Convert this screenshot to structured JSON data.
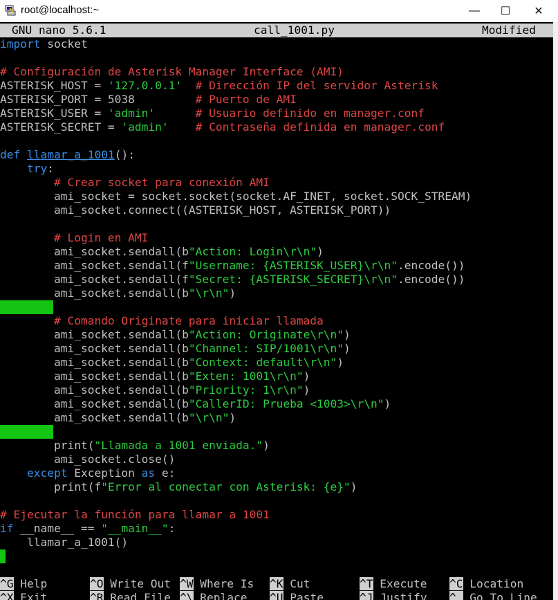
{
  "window": {
    "title": "root@localhost:~",
    "controls": {
      "minimize": "—",
      "maximize": "☐",
      "close": "✕"
    }
  },
  "editor": {
    "app": "GNU nano 5.6.1",
    "filename": "call_1001.py",
    "status": "Modified"
  },
  "code": [
    "import socket",
    "",
    "# Configuración de Asterisk Manager Interface (AMI)",
    "ASTERISK_HOST = '127.0.0.1'  # Dirección IP del servidor Asterisk",
    "ASTERISK_PORT = 5038         # Puerto de AMI",
    "ASTERISK_USER = 'admin'      # Usuario definido en manager.conf",
    "ASTERISK_SECRET = 'admin'    # Contraseña definida en manager.conf",
    "",
    "def llamar_a_1001():",
    "    try:",
    "        # Crear socket para conexión AMI",
    "        ami_socket = socket.socket(socket.AF_INET, socket.SOCK_STREAM)",
    "        ami_socket.connect((ASTERISK_HOST, ASTERISK_PORT))",
    "",
    "        # Login en AMI",
    "        ami_socket.sendall(b\"Action: Login\\r\\n\")",
    "        ami_socket.sendall(f\"Username: {ASTERISK_USER}\\r\\n\".encode())",
    "        ami_socket.sendall(f\"Secret: {ASTERISK_SECRET}\\r\\n\".encode())",
    "        ami_socket.sendall(b\"\\r\\n\")",
    "        ",
    "        # Comando Originate para iniciar llamada",
    "        ami_socket.sendall(b\"Action: Originate\\r\\n\")",
    "        ami_socket.sendall(b\"Channel: SIP/1001\\r\\n\")",
    "        ami_socket.sendall(b\"Context: default\\r\\n\")",
    "        ami_socket.sendall(b\"Exten: 1001\\r\\n\")",
    "        ami_socket.sendall(b\"Priority: 1\\r\\n\")",
    "        ami_socket.sendall(b\"CallerID: Prueba <1003>\\r\\n\")",
    "        ami_socket.sendall(b\"\\r\\n\")",
    "        ",
    "        print(\"Llamada a 1001 enviada.\")",
    "        ami_socket.close()",
    "    except Exception as e:",
    "        print(f\"Error al conectar con Asterisk: {e}\")",
    "",
    "# Ejecutar la función para llamar a 1001",
    "if __name__ == \"__main__\":",
    "    llamar_a_1001()",
    ""
  ],
  "shortcuts": [
    {
      "key": "^G",
      "label": "Help"
    },
    {
      "key": "^O",
      "label": "Write Out"
    },
    {
      "key": "^W",
      "label": "Where Is"
    },
    {
      "key": "^K",
      "label": "Cut"
    },
    {
      "key": "^T",
      "label": "Execute"
    },
    {
      "key": "^C",
      "label": "Location"
    },
    {
      "key": "^X",
      "label": "Exit"
    },
    {
      "key": "^R",
      "label": "Read File"
    },
    {
      "key": "^\\",
      "label": "Replace"
    },
    {
      "key": "^U",
      "label": "Paste"
    },
    {
      "key": "^J",
      "label": "Justify"
    },
    {
      "key": "^_",
      "label": "Go To Line"
    }
  ],
  "colors": {
    "keyword": "#3a8ee6",
    "comment": "#e04545",
    "string": "#2ecc40",
    "highlight": "#13c413"
  }
}
